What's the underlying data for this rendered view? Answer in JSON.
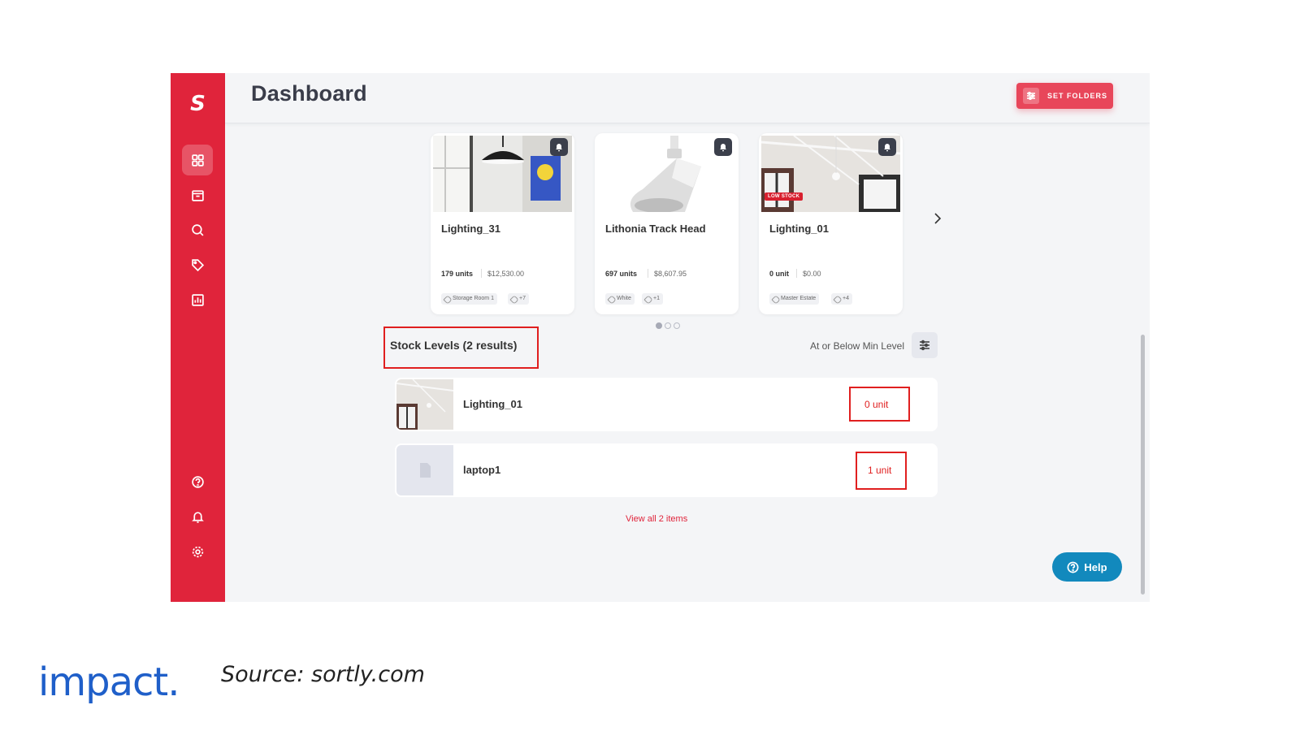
{
  "app": {
    "logo": "S",
    "page_title": "Dashboard",
    "set_folders_label": "SET FOLDERS",
    "sidebar_icons": [
      "dashboard-icon",
      "box-icon",
      "search-icon",
      "tags-icon",
      "reports-icon",
      "help-circle-icon",
      "bell-icon",
      "gear-icon"
    ],
    "accent_color": "#e0243b"
  },
  "cards": [
    {
      "name": "Lighting_31",
      "units": "179 units",
      "price": "$12,530.00",
      "tags": [
        "Storage Room 1",
        "+7"
      ]
    },
    {
      "name": "Lithonia Track Head",
      "units": "697 units",
      "price": "$8,607.95",
      "tags": [
        "White",
        "+1"
      ]
    },
    {
      "name": "Lighting_01",
      "units": "0 unit",
      "price": "$0.00",
      "tags": [
        "Master Estate",
        "+4"
      ],
      "badge": "LOW STOCK"
    }
  ],
  "carousel": {
    "pages": 3,
    "active": 0
  },
  "stock": {
    "title": "Stock Levels (2 results)",
    "filter_label": "At or Below Min Level",
    "rows": [
      {
        "name": "Lighting_01",
        "qty": "0 unit"
      },
      {
        "name": "laptop1",
        "qty": "1 unit"
      }
    ],
    "view_all": "View all 2 items"
  },
  "help_label": "Help",
  "footer": {
    "brand": "impact.",
    "source": "Source: sortly.com"
  }
}
